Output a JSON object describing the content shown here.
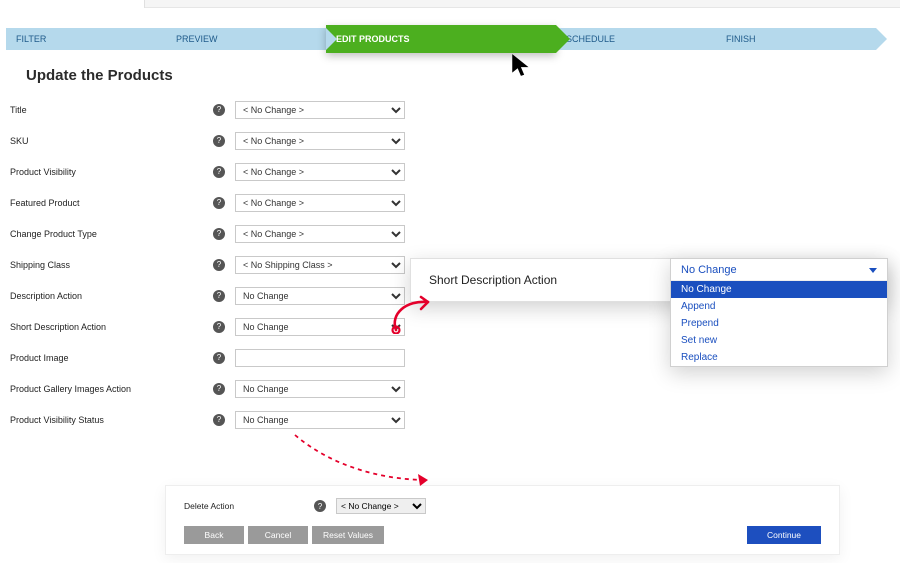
{
  "steps": [
    "FILTER",
    "PREVIEW",
    "EDIT PRODUCTS",
    "SCHEDULE",
    "FINISH"
  ],
  "active_step": 2,
  "section_title": "Update the Products",
  "help_glyph": "?",
  "fields": [
    {
      "label": "Title",
      "value": "< No Change >"
    },
    {
      "label": "SKU",
      "value": "< No Change >"
    },
    {
      "label": "Product Visibility",
      "value": "< No Change >"
    },
    {
      "label": "Featured Product",
      "value": "< No Change >"
    },
    {
      "label": "Change Product Type",
      "value": "< No Change >"
    },
    {
      "label": "Shipping Class",
      "value": "< No Shipping Class >"
    },
    {
      "label": "Description Action",
      "value": "No Change"
    },
    {
      "label": "Short Description Action",
      "value": "No Change"
    },
    {
      "label": "Product Image",
      "value": "",
      "type": "text"
    },
    {
      "label": "Product Gallery Images Action",
      "value": "No Change"
    },
    {
      "label": "Product Visibility Status",
      "value": "No Change"
    }
  ],
  "popover": {
    "title": "Short Description Action",
    "selected": "No Change",
    "options": [
      "No Change",
      "Append",
      "Prepend",
      "Set new",
      "Replace"
    ],
    "highlight_index": 0
  },
  "footer": {
    "delete_label": "Delete Action",
    "delete_value": "< No Change >",
    "buttons": {
      "back": "Back",
      "cancel": "Cancel",
      "reset": "Reset Values",
      "continue": "Continue"
    }
  }
}
